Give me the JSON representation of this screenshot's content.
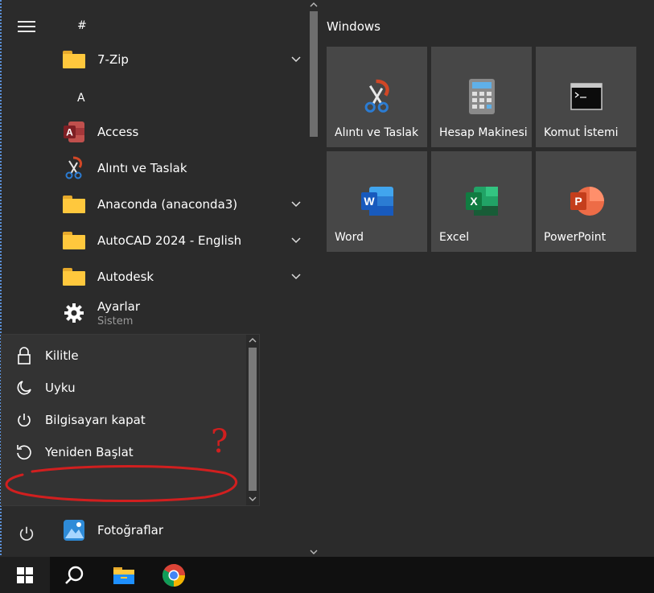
{
  "apps_list": {
    "section_hash": "#",
    "section_a": "A",
    "items": [
      {
        "label": "7-Zip"
      },
      {
        "label": "Access"
      },
      {
        "label": "Alıntı ve Taslak"
      },
      {
        "label": "Anaconda (anaconda3)"
      },
      {
        "label": "AutoCAD 2024 - English"
      },
      {
        "label": "Autodesk"
      },
      {
        "label": "Ayarlar",
        "sublabel": "Sistem"
      },
      {
        "label": "Fotoğraflar"
      }
    ]
  },
  "power_menu": {
    "items": [
      {
        "label": "Kilitle"
      },
      {
        "label": "Uyku"
      },
      {
        "label": "Bilgisayarı kapat"
      },
      {
        "label": "Yeniden Başlat"
      }
    ]
  },
  "tiles": {
    "group_title": "Windows",
    "items": [
      {
        "label": "Alıntı ve Taslak"
      },
      {
        "label": "Hesap Makinesi"
      },
      {
        "label": "Komut İstemi"
      },
      {
        "label": "Word"
      },
      {
        "label": "Excel"
      },
      {
        "label": "PowerPoint"
      }
    ]
  },
  "annotation": {
    "text": "?",
    "color": "#d11f1f"
  },
  "colors": {
    "folder": "#ffc83d",
    "access": "#a4373a",
    "word": "#2b7cd3",
    "excel": "#1f7a45",
    "powerpoint": "#d24726"
  }
}
